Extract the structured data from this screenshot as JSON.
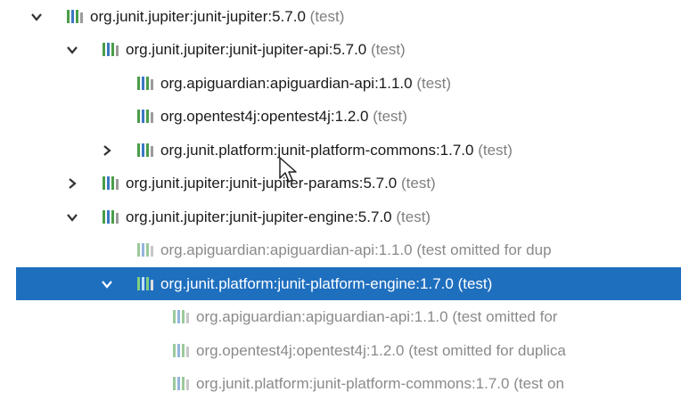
{
  "colors": {
    "selection": "#1f6fbf",
    "scope_text": "#7f7f7f",
    "omitted_text": "#8a8a8a",
    "lib_icon": [
      "#4a9e4a",
      "#3b78c4",
      "#9b9b9b"
    ]
  },
  "tree": [
    {
      "name": "org.junit.jupiter:junit-jupiter:5.7.0",
      "scope": "(test)",
      "arrow": "expanded"
    },
    {
      "name": "org.junit.jupiter:junit-jupiter-api:5.7.0",
      "scope": "(test)",
      "arrow": "expanded"
    },
    {
      "name": "org.apiguardian:apiguardian-api:1.1.0",
      "scope": "(test)",
      "arrow": "none"
    },
    {
      "name": "org.opentest4j:opentest4j:1.2.0",
      "scope": "(test)",
      "arrow": "none"
    },
    {
      "name": "org.junit.platform:junit-platform-commons:1.7.0",
      "scope": "(test)",
      "arrow": "collapsed"
    },
    {
      "name": "org.junit.jupiter:junit-jupiter-params:5.7.0",
      "scope": "(test)",
      "arrow": "collapsed"
    },
    {
      "name": "org.junit.jupiter:junit-jupiter-engine:5.7.0",
      "scope": "(test)",
      "arrow": "expanded"
    },
    {
      "name": "org.apiguardian:apiguardian-api:1.1.0",
      "scope": "(test omitted for dup",
      "arrow": "none",
      "omitted": true
    },
    {
      "name": "org.junit.platform:junit-platform-engine:1.7.0",
      "scope": "(test)",
      "arrow": "expanded",
      "selected": true
    },
    {
      "name": "org.apiguardian:apiguardian-api:1.1.0",
      "scope": "(test omitted for",
      "arrow": "none",
      "omitted": true
    },
    {
      "name": "org.opentest4j:opentest4j:1.2.0",
      "scope": "(test omitted for duplica",
      "arrow": "none",
      "omitted": true
    },
    {
      "name": "org.junit.platform:junit-platform-commons:1.7.0",
      "scope": "(test on",
      "arrow": "none",
      "omitted": true
    }
  ]
}
